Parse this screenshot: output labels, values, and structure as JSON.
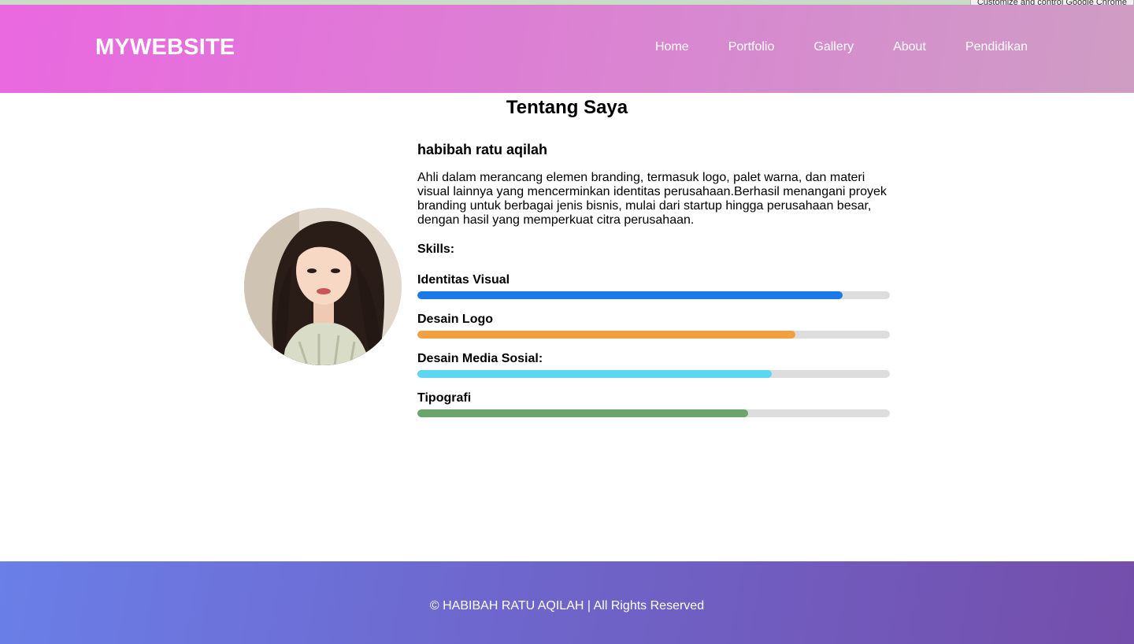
{
  "browser": {
    "tooltip": "Customize and control Google Chrome"
  },
  "header": {
    "logo": "MYWEBSITE",
    "nav": [
      {
        "label": "Home"
      },
      {
        "label": "Portfolio"
      },
      {
        "label": "Gallery"
      },
      {
        "label": "About"
      },
      {
        "label": "Pendidikan"
      }
    ]
  },
  "about": {
    "title": "Tentang Saya",
    "name": "habibah ratu aqilah",
    "bio": "Ahli dalam merancang elemen branding, termasuk logo, palet warna, dan materi visual lainnya yang mencerminkan identitas perusahaan.Berhasil menangani proyek branding untuk berbagai jenis bisnis, mulai dari startup hingga perusahaan besar, dengan hasil yang memperkuat citra perusahaan.",
    "skills_heading": "Skills:",
    "skills": [
      {
        "label": "Identitas Visual",
        "level": 0.9,
        "color": "#1a7ae8"
      },
      {
        "label": "Desain Logo",
        "level": 0.8,
        "color": "#f0a040"
      },
      {
        "label": "Desain Media Sosial:",
        "level": 0.75,
        "color": "#5dd6f2"
      },
      {
        "label": "Tipografi",
        "level": 0.7,
        "color": "#6aa66a"
      }
    ]
  },
  "footer": {
    "copyright": "© HABIBAH RATU AQILAH | All Rights Reserved"
  },
  "colors": {
    "header_gradient_start": "#ea68e0",
    "header_gradient_end": "#cf9dc4",
    "footer_gradient_start": "#6a7fe8",
    "footer_gradient_end": "#744eab",
    "bar_track": "#dddddd"
  }
}
